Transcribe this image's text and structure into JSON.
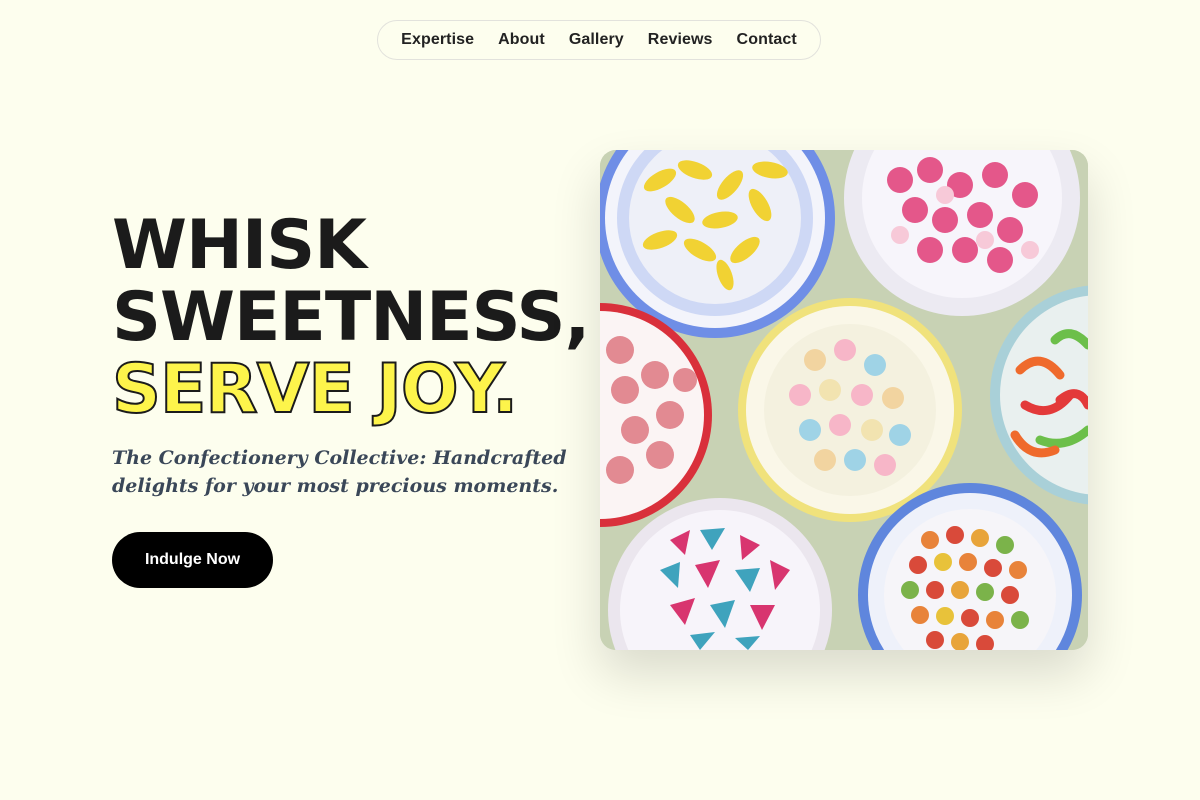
{
  "nav": {
    "items": [
      {
        "label": "Expertise"
      },
      {
        "label": "About"
      },
      {
        "label": "Gallery"
      },
      {
        "label": "Reviews"
      },
      {
        "label": "Contact"
      }
    ]
  },
  "hero": {
    "headline_line1": "WHISK",
    "headline_line2": "SWEETNESS,",
    "headline_accent": "SERVE JOY.",
    "subtitle": "The Confectionery Collective: Handcrafted delights for your most precious moments.",
    "cta_label": "Indulge Now",
    "image_alt": "Plates of assorted colorful candies"
  },
  "colors": {
    "background": "#fdfeee",
    "accent_yellow": "#fdf44b",
    "text_dark": "#1b1b1b",
    "subtitle": "#3a4758",
    "button": "#000000"
  }
}
